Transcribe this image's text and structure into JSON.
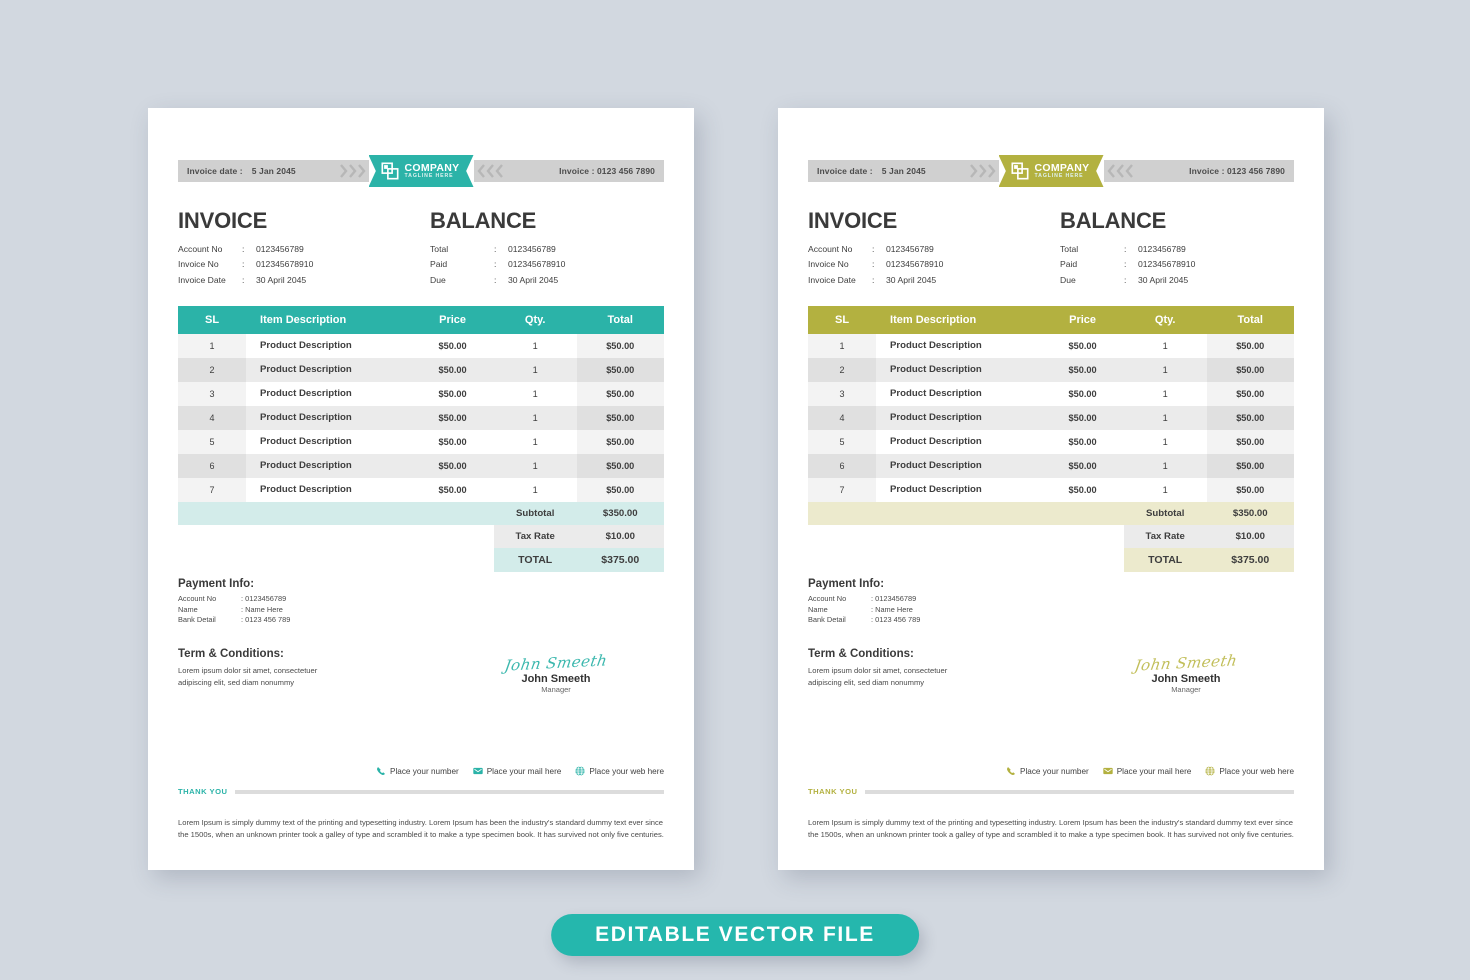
{
  "canvas": {
    "background_color": "#d2d8e0"
  },
  "badge": {
    "label": "EDITABLE VECTOR  FILE",
    "color": "#25b7ad"
  },
  "shared": {
    "band": {
      "invoice_date_label": "Invoice date :",
      "invoice_date_value": "5 Jan 2045",
      "invoice_no_label": "Invoice : 0123 456 7890"
    },
    "logo": {
      "name": "COMPANY",
      "tagline": "TAGLINE HERE"
    },
    "invoice_block": {
      "title": "INVOICE",
      "rows": [
        {
          "label": "Account No",
          "sep": ":",
          "value": "0123456789"
        },
        {
          "label": "Invoice No",
          "sep": ":",
          "value": "012345678910"
        },
        {
          "label": "Invoice Date",
          "sep": ":",
          "value": "30 April 2045"
        }
      ]
    },
    "balance_block": {
      "title": "BALANCE",
      "rows": [
        {
          "label": "Total",
          "sep": ":",
          "value": "0123456789"
        },
        {
          "label": "Paid",
          "sep": ":",
          "value": "012345678910"
        },
        {
          "label": "Due",
          "sep": ":",
          "value": "30 April 2045"
        }
      ]
    },
    "table": {
      "headers": [
        "SL",
        "Item Description",
        "Price",
        "Qty.",
        "Total"
      ],
      "rows": [
        {
          "sl": "1",
          "desc": "Product Description",
          "price": "$50.00",
          "qty": "1",
          "total": "$50.00"
        },
        {
          "sl": "2",
          "desc": "Product Description",
          "price": "$50.00",
          "qty": "1",
          "total": "$50.00"
        },
        {
          "sl": "3",
          "desc": "Product Description",
          "price": "$50.00",
          "qty": "1",
          "total": "$50.00"
        },
        {
          "sl": "4",
          "desc": "Product Description",
          "price": "$50.00",
          "qty": "1",
          "total": "$50.00"
        },
        {
          "sl": "5",
          "desc": "Product Description",
          "price": "$50.00",
          "qty": "1",
          "total": "$50.00"
        },
        {
          "sl": "6",
          "desc": "Product Description",
          "price": "$50.00",
          "qty": "1",
          "total": "$50.00"
        },
        {
          "sl": "7",
          "desc": "Product Description",
          "price": "$50.00",
          "qty": "1",
          "total": "$50.00"
        }
      ]
    },
    "summary": {
      "subtotal_label": "Subtotal",
      "subtotal_value": "$350.00",
      "tax_label": "Tax Rate",
      "tax_value": "$10.00",
      "total_label": "TOTAL",
      "total_value": "$375.00"
    },
    "payment": {
      "title": "Payment Info:",
      "rows": [
        {
          "label": "Account No",
          "value": ": 0123456789"
        },
        {
          "label": "Name",
          "value": ": Name Here"
        },
        {
          "label": "Bank Detail",
          "value": ": 0123 456 789"
        }
      ]
    },
    "terms": {
      "title": "Term & Conditions:",
      "body": "Lorem ipsum dolor sit amet, consectetuer adipiscing elit, sed diam nonummy"
    },
    "signature": {
      "script": "John Smeeth",
      "name": "John Smeeth",
      "role": "Manager"
    },
    "contacts": [
      {
        "icon": "phone-icon",
        "label": "Place your number"
      },
      {
        "icon": "mail-icon",
        "label": "Place your mail here"
      },
      {
        "icon": "globe-icon",
        "label": "Place your web here"
      }
    ],
    "thanks_label": "THANK YOU",
    "footnote": "Lorem Ipsum is simply dummy text of the printing and typesetting industry. Lorem Ipsum has been the industry's standard dummy text ever since the 1500s, when an unknown printer took a galley of type and scrambled it to make a type specimen book. It has survived not only five centuries."
  },
  "variants": {
    "left": {
      "name": "teal-variant",
      "accent": "#2bb3a8",
      "accent_soft": "#d3ecea",
      "thanks_color": "#2bb3a8",
      "signature_color": "#3cb8ae"
    },
    "right": {
      "name": "olive-variant",
      "accent": "#b3b140",
      "accent_soft": "#eceacd",
      "thanks_color": "#b3b140",
      "signature_color": "#c2bf5b"
    }
  }
}
